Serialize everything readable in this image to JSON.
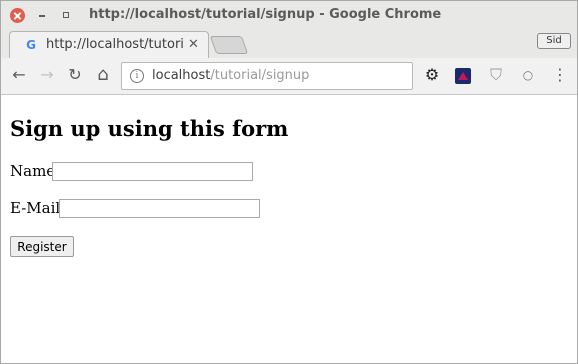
{
  "window": {
    "title": "http://localhost/tutorial/signup - Google Chrome"
  },
  "tab": {
    "title": "http://localhost/tutorial/signup",
    "favicon": "google-g-icon",
    "close_glyph": "✕"
  },
  "profile": {
    "label": "Sid"
  },
  "toolbar": {
    "back_glyph": "←",
    "forward_glyph": "→",
    "reload_glyph": "↻",
    "home_glyph": "⌂",
    "info_glyph": "i",
    "url_host": "localhost",
    "url_path": "/tutorial/signup",
    "ext_settings_glyph": "⚙",
    "ext_shield_glyph": "⛉",
    "ext_circle_glyph": "○",
    "menu_glyph": "⋮"
  },
  "page": {
    "heading": "Sign up using this form",
    "name_label": "Name",
    "name_value": "",
    "email_label": "E-Mail",
    "email_value": "",
    "register_label": "Register"
  },
  "colors": {
    "close_button": "#e25c4b",
    "chrome_frame": "#e8e8e7"
  }
}
